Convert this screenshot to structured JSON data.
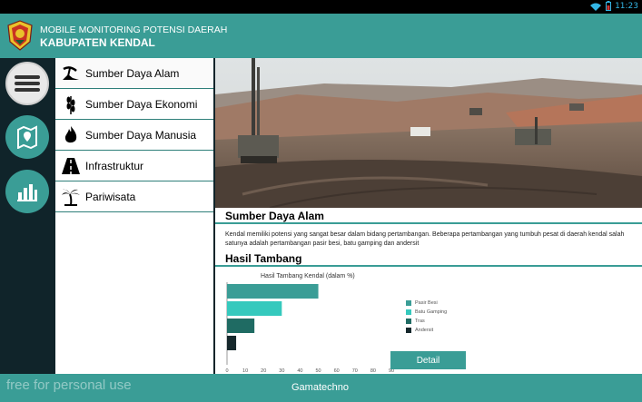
{
  "status_bar": {
    "time": "11:23"
  },
  "app": {
    "title": "MOBILE MONITORING POTENSI DAERAH",
    "subtitle": "KABUPATEN KENDAL"
  },
  "rail": {
    "buttons": [
      {
        "icon": "menu-icon"
      },
      {
        "icon": "map-icon"
      },
      {
        "icon": "bar-chart-icon"
      }
    ]
  },
  "categories": [
    {
      "label": "Sumber Daya Alam",
      "icon": "mining-icon"
    },
    {
      "label": "Sumber Daya Ekonomi",
      "icon": "wheat-icon"
    },
    {
      "label": "Sumber Daya Manusia",
      "icon": "flame-icon"
    },
    {
      "label": "Infrastruktur",
      "icon": "road-icon"
    },
    {
      "label": "Pariwisata",
      "icon": "palm-tree-icon"
    }
  ],
  "content": {
    "section_title": "Sumber Daya Alam",
    "description": "Kendal memiliki potensi yang sangat besar dalam bidang pertambangan. Beberapa pertambangan yang tumbuh pesat di daerah kendal salah satunya adalah pertambangan pasir besi, batu gamping dan andersit",
    "subsection_title": "Hasil Tambang",
    "detail_button": "Detail"
  },
  "chart_data": {
    "type": "bar",
    "orientation": "horizontal",
    "title": "Hasil Tambang Kendal (dalam %)",
    "categories": [
      "Pasir Besi",
      "Batu Gamping",
      "Tras",
      "Andersit"
    ],
    "values": [
      50,
      30,
      15,
      5
    ],
    "colors": [
      "#3a9d96",
      "#35c9bd",
      "#1f6b63",
      "#16282c"
    ],
    "xlim": [
      0,
      90
    ],
    "xticks": [
      "0",
      "10",
      "20",
      "30",
      "40",
      "50",
      "60",
      "70",
      "80",
      "90"
    ],
    "legend": "right",
    "grid": false
  },
  "footer": {
    "watermark": "free for personal use",
    "label": "Gamatechno"
  }
}
